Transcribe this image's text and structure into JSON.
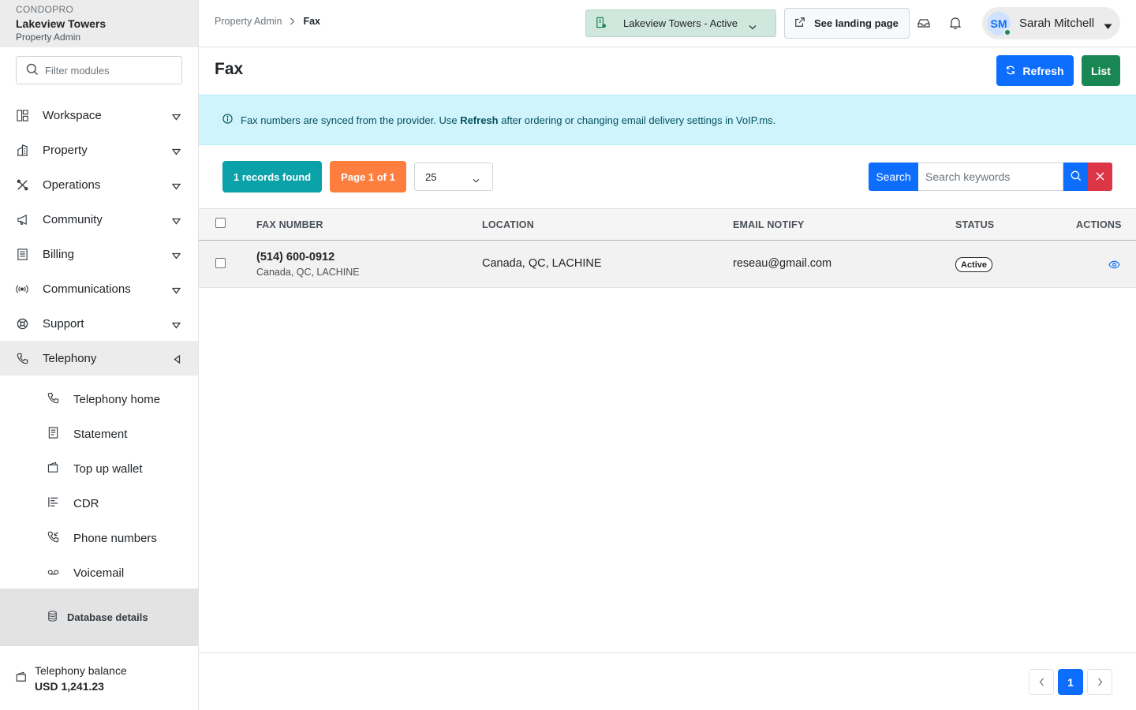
{
  "brand": {
    "org": "CONDOPRO",
    "property": "Lakeview Towers",
    "role": "Property Admin"
  },
  "sidebar": {
    "filter_placeholder": "Filter modules",
    "items": [
      {
        "label": "Workspace",
        "icon": "layout-icon"
      },
      {
        "label": "Property",
        "icon": "building-icon"
      },
      {
        "label": "Operations",
        "icon": "tools-icon"
      },
      {
        "label": "Community",
        "icon": "megaphone-icon"
      },
      {
        "label": "Billing",
        "icon": "receipt-icon"
      },
      {
        "label": "Communications",
        "icon": "broadcast-icon"
      },
      {
        "label": "Support",
        "icon": "lifebuoy-icon"
      },
      {
        "label": "Telephony",
        "icon": "phone-icon"
      }
    ],
    "subitems": [
      {
        "label": "Telephony home",
        "icon": "phone-icon"
      },
      {
        "label": "Statement",
        "icon": "statement-icon"
      },
      {
        "label": "Top up wallet",
        "icon": "wallet-icon"
      },
      {
        "label": "CDR",
        "icon": "list-icon"
      },
      {
        "label": "Phone numbers",
        "icon": "phone-incoming-icon"
      },
      {
        "label": "Voicemail",
        "icon": "voicemail-icon"
      }
    ],
    "database_label": "Database details",
    "balance_label": "Telephony balance",
    "balance_value": "USD 1,241.23"
  },
  "topbar": {
    "breadcrumb_parent": "Property Admin",
    "breadcrumb_current": "Fax",
    "property_select": "Lakeview Towers - Active",
    "landing_label": "See landing page",
    "user_initials": "SM",
    "user_name": "Sarah Mitchell"
  },
  "page": {
    "title": "Fax",
    "refresh_label": "Refresh",
    "list_label": "List"
  },
  "info": {
    "before": "Fax numbers are synced from the provider. Use ",
    "bold": "Refresh",
    "after": " after ordering or changing email delivery settings in VoIP.ms."
  },
  "toolbar": {
    "records": "1 records found",
    "page": "Page 1 of 1",
    "per_page": "25",
    "search_label": "Search",
    "search_placeholder": "Search keywords"
  },
  "table": {
    "headers": [
      "FAX NUMBER",
      "LOCATION",
      "EMAIL NOTIFY",
      "STATUS",
      "ACTIONS"
    ],
    "rows": [
      {
        "fax_number": "(514) 600-0912",
        "fax_location_sub": "Canada, QC, LACHINE",
        "location": "Canada, QC, LACHINE",
        "email": "reseau@gmail.com",
        "status": "Active"
      }
    ]
  },
  "pagination": {
    "current": "1"
  },
  "colors": {
    "primary": "#0d6efd",
    "success": "#198754",
    "info_bg": "#cff4fc",
    "records_badge": "#0aa2a8",
    "page_badge": "#fd7e3f",
    "danger": "#dc3545"
  }
}
